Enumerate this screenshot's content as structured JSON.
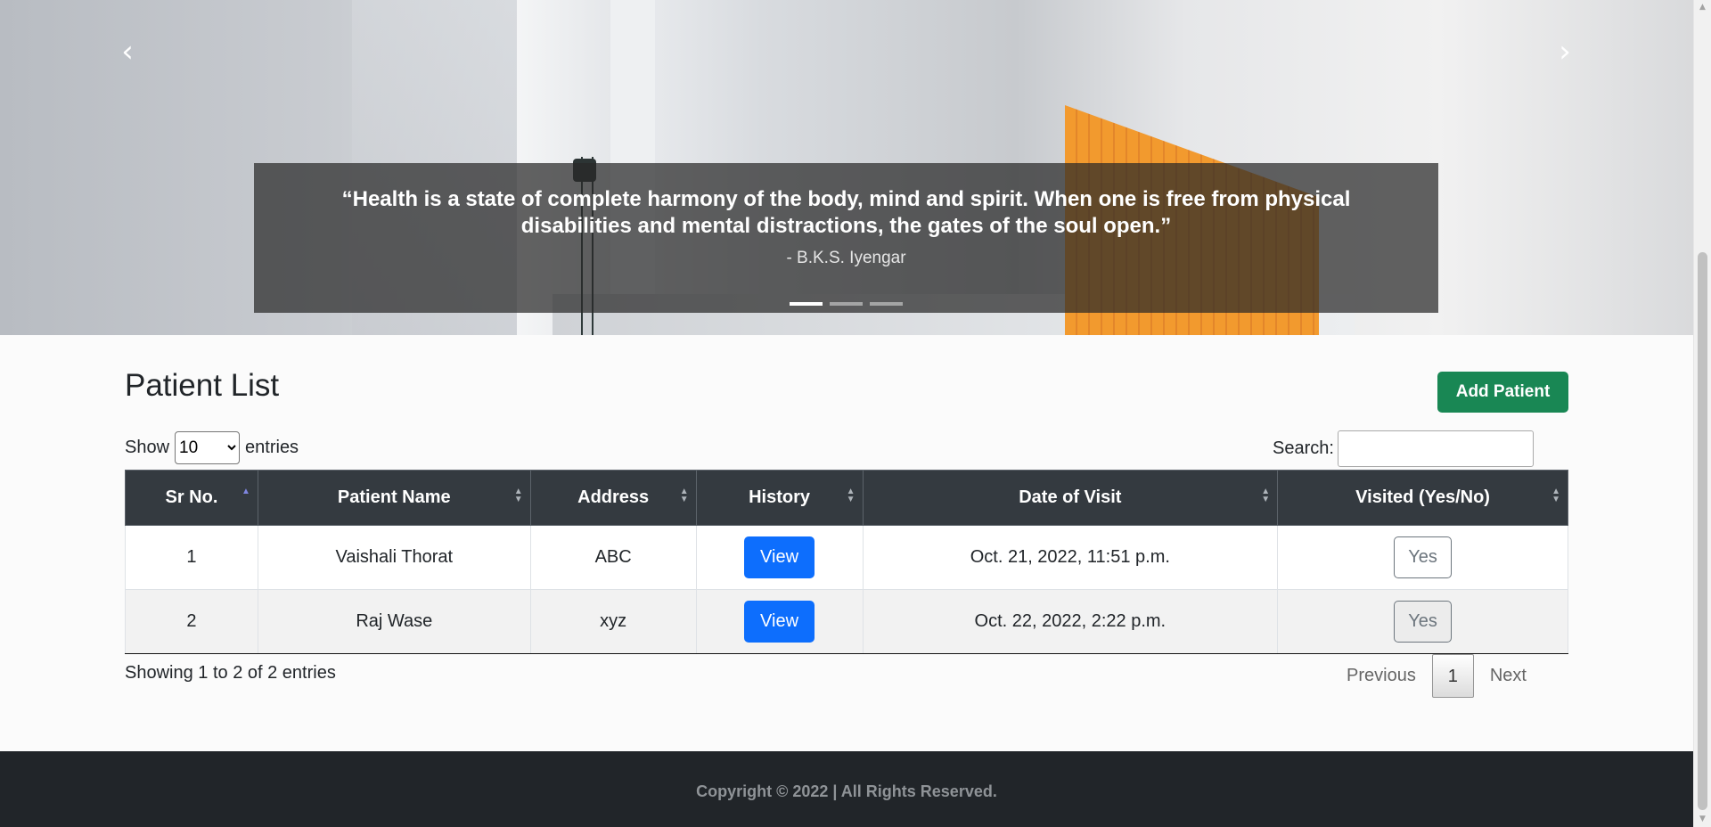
{
  "carousel": {
    "prev_icon": "chevron-left-icon",
    "next_icon": "chevron-right-icon",
    "prev_glyph": "‹",
    "next_glyph": "›",
    "quote": "“Health is a state of complete harmony of the body, mind and spirit. When one is free from physical disabilities and mental distractions, the gates of the soul open.”",
    "author": "- B.K.S. Iyengar",
    "slide_count": 3,
    "active_slide": 1
  },
  "page": {
    "title": "Patient List",
    "add_button": "Add Patient"
  },
  "length_menu": {
    "prefix": "Show",
    "selected": "10",
    "suffix": "entries"
  },
  "search": {
    "label": "Search:",
    "value": ""
  },
  "table": {
    "headers": [
      "Sr No.",
      "Patient Name",
      "Address",
      "History",
      "Date of Visit",
      "Visited (Yes/No)"
    ],
    "rows": [
      {
        "sr": "1",
        "name": "Vaishali Thorat",
        "address": "ABC",
        "history": "View",
        "date": "Oct. 21, 2022, 11:51 p.m.",
        "visited": "Yes"
      },
      {
        "sr": "2",
        "name": "Raj Wase",
        "address": "xyz",
        "history": "View",
        "date": "Oct. 22, 2022, 2:22 p.m.",
        "visited": "Yes"
      }
    ]
  },
  "info": "Showing 1 to 2 of 2 entries",
  "pagination": {
    "previous": "Previous",
    "current": "1",
    "next": "Next"
  },
  "footer": "Copyright © 2022 | All Rights Reserved.",
  "colors": {
    "header_bg": "#343a40",
    "add_button": "#198754",
    "view_button": "#0d6efd",
    "footer_bg": "#212529"
  }
}
